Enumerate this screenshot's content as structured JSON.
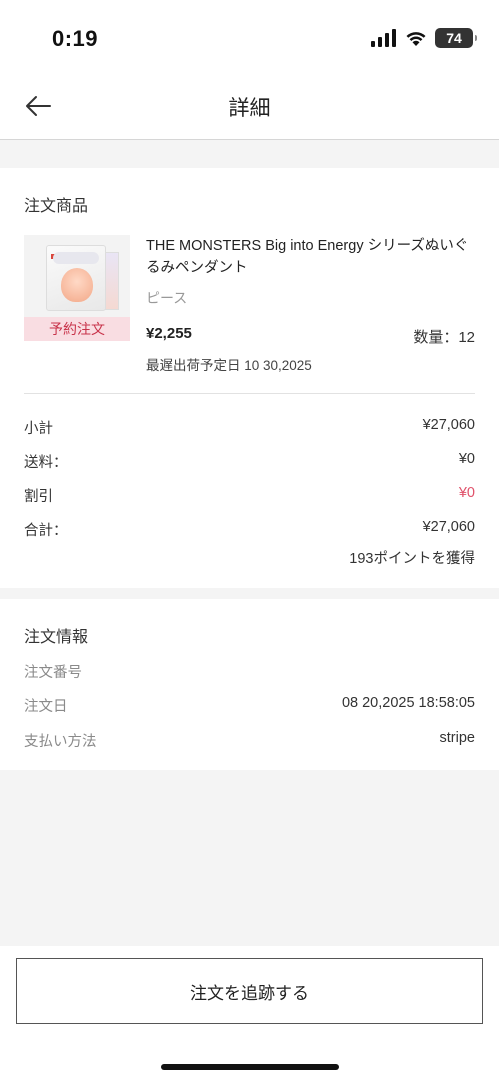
{
  "status_bar": {
    "time": "0:19",
    "battery": "74"
  },
  "nav": {
    "title": "詳細"
  },
  "products_section": {
    "title": "注文商品",
    "product": {
      "name": "THE MONSTERS Big into Energy シリーズぬいぐるみペンダント",
      "variant": "ピース",
      "badge": "予約注文",
      "price": "¥2,255",
      "quantity": "数量：12",
      "ship_date": "最遅出荷予定日 10 30,2025"
    },
    "summary": {
      "subtotal_label": "小計",
      "subtotal_value": "¥27,060",
      "shipping_label": "送料：",
      "shipping_value": "¥0",
      "discount_label": "割引",
      "discount_value": "¥0",
      "total_label": "合計：",
      "total_value": "¥27,060",
      "points": "193ポイントを獲得"
    }
  },
  "info_section": {
    "title": "注文情報",
    "order_no_label": "注文番号",
    "order_date_label": "注文日",
    "order_date_value": "08 20,2025 18:58:05",
    "payment_label": "支払い方法",
    "payment_value": "stripe"
  },
  "bottom": {
    "track_button": "注文を追跡する"
  },
  "colors": {
    "accent_red": "#e0516a",
    "badge_bg": "#f9dde2",
    "badge_text": "#c8334a"
  }
}
